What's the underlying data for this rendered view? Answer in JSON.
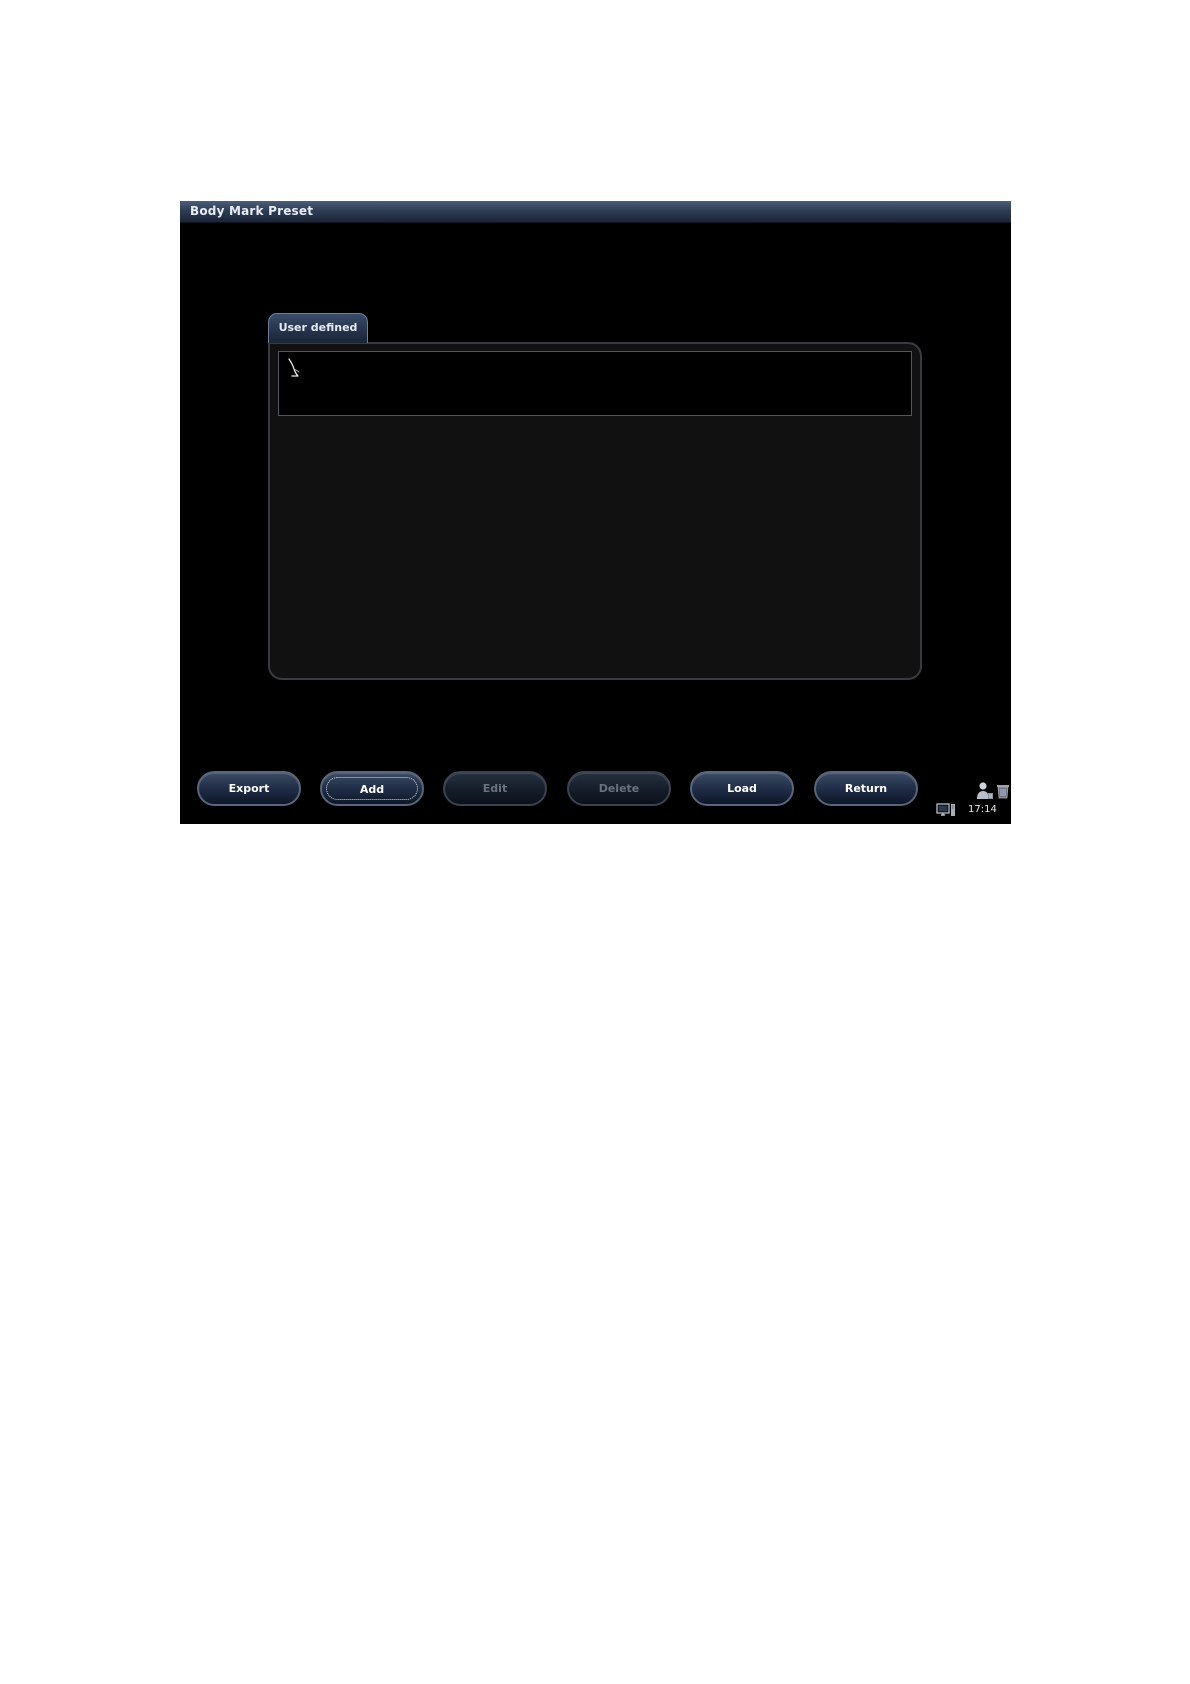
{
  "window": {
    "title": "Body Mark Preset"
  },
  "tabs": [
    {
      "label": "User defined",
      "active": true
    }
  ],
  "marks": [
    {
      "icon": "body-mark-icon"
    }
  ],
  "buttons": {
    "export": {
      "label": "Export",
      "enabled": true
    },
    "add": {
      "label": "Add",
      "enabled": true,
      "focused": true
    },
    "edit": {
      "label": "Edit",
      "enabled": false
    },
    "delete": {
      "label": "Delete",
      "enabled": false
    },
    "load": {
      "label": "Load",
      "enabled": true
    },
    "return": {
      "label": "Return",
      "enabled": true
    }
  },
  "status": {
    "time": "17:14",
    "icons": [
      "user-icon",
      "recycle-bin-icon",
      "computer-icon"
    ]
  },
  "colors": {
    "background": "#000000",
    "titlebar": "#2f3d55",
    "tab": "#24324a",
    "panel": "#111112",
    "list_border": "#4d5577"
  }
}
